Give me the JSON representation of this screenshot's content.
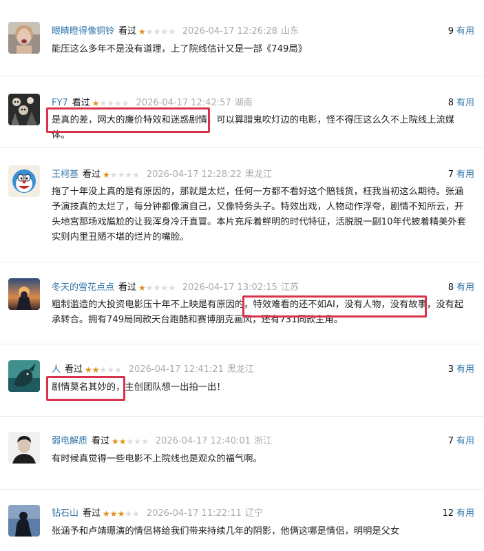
{
  "useful_label": "有用",
  "highlight_color": "#d8334a",
  "star_color": "#e09015",
  "reviews": [
    {
      "user": "眼睛瞪得像铜铃",
      "status": "看过",
      "rating": 1,
      "time": "2026-04-17 12:26:28",
      "location": "山东",
      "useful": "9",
      "content": "能压这么多年不是没有道理，上了院线估计又是一部《749局》",
      "avatar_icon": "woman-portrait-icon"
    },
    {
      "user": "FY7",
      "status": "看过",
      "rating": 1,
      "time": "2026-04-17 12:42:57",
      "location": "湖南",
      "useful": "8",
      "content": "是真的差，网大的廉价特效和迷惑剧情，可以算蹭鬼吹灯边的电影，怪不得压这么久不上院线上流媒体。",
      "avatar_icon": "horror-figures-icon"
    },
    {
      "user": "王柯基",
      "status": "看过",
      "rating": 1,
      "time": "2026-04-17 12:28:22",
      "location": "黑龙江",
      "useful": "7",
      "content": "拖了十年没上真的是有原因的，那就是太烂，任何一方都不看好这个赔钱货，枉我当初这么期待。张涵予演技真的太烂了，每分钟都像演自己，又像特务头子。特效出戏，人物动作浮夸，剧情不知所云，开头地宫那场戏尴尬的让我浑身冷汗直冒。本片充斥着鲜明的时代特征，活脱脱一副10年代披着精美外套实则内里丑陋不堪的烂片的嘴脸。",
      "avatar_icon": "cartoon-character-icon"
    },
    {
      "user": "冬天的雪花点点",
      "status": "看过",
      "rating": 1,
      "time": "2026-04-17 13:02:15",
      "location": "江苏",
      "useful": "8",
      "content": "粗制滥造的大投资电影压十年不上映是有原因的，特效难看的还不如AI，没有人物，没有故事，没有起承转合。拥有749局同款天台跑酷和赛博朋克画风，还有731同款主角。",
      "avatar_icon": "sunset-figure-icon"
    },
    {
      "user": "人",
      "status": "看过",
      "rating": 2,
      "time": "2026-04-17 12:41:21",
      "location": "黑龙江",
      "useful": "3",
      "content": "剧情莫名其妙的，主创团队想一出拍一出！",
      "avatar_icon": "sea-creature-icon"
    },
    {
      "user": "弱电解质",
      "status": "看过",
      "rating": 2,
      "time": "2026-04-17 12:40:01",
      "location": "浙江",
      "useful": "7",
      "content": "有时候真觉得一些电影不上院线也是观众的福气啊。",
      "avatar_icon": "man-portrait-icon"
    },
    {
      "user": "钻石山",
      "status": "看过",
      "rating": 3,
      "time": "2026-04-17 11:22:11",
      "location": "辽宁",
      "useful": "12",
      "content": "张涵予和卢靖珊演的情侣将给我们带来持续几年的阴影，他俩这哪是情侣，明明是父女",
      "avatar_icon": "silhouette-icon"
    }
  ]
}
